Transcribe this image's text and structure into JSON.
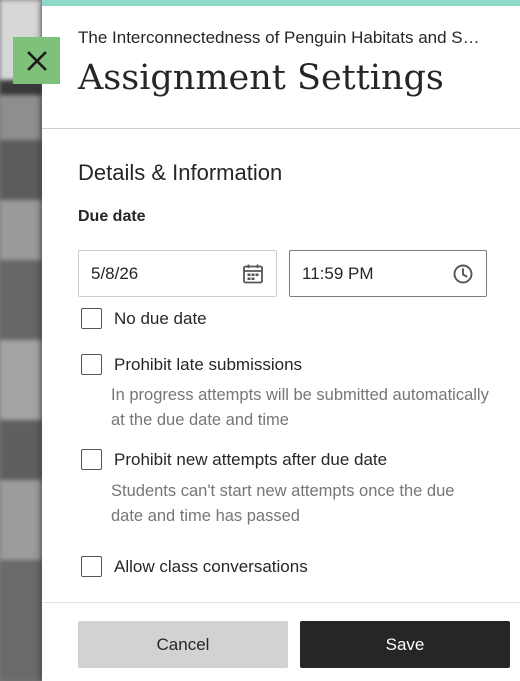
{
  "panel": {
    "breadcrumb": "The Interconnectedness of Penguin Habitats and S…",
    "title": "Assignment Settings",
    "accent_color": "#8fd8c8",
    "close_button_color": "#7dc17b"
  },
  "details": {
    "section_title": "Details & Information",
    "due_date_label": "Due date",
    "date_value": "5/8/26",
    "time_value": "11:59 PM",
    "date_icon": "calendar-icon",
    "time_icon": "clock-icon"
  },
  "options": [
    {
      "label": "No due date",
      "checked": false,
      "helper": ""
    },
    {
      "label": "Prohibit late submissions",
      "checked": false,
      "helper": "In progress attempts will be submitted automatically at the due date and time"
    },
    {
      "label": "Prohibit new attempts after due date",
      "checked": false,
      "helper": "Students can't start new attempts once the due date and time has passed"
    },
    {
      "label": "Allow class conversations",
      "checked": false,
      "helper": ""
    }
  ],
  "footer": {
    "cancel_label": "Cancel",
    "save_label": "Save"
  }
}
